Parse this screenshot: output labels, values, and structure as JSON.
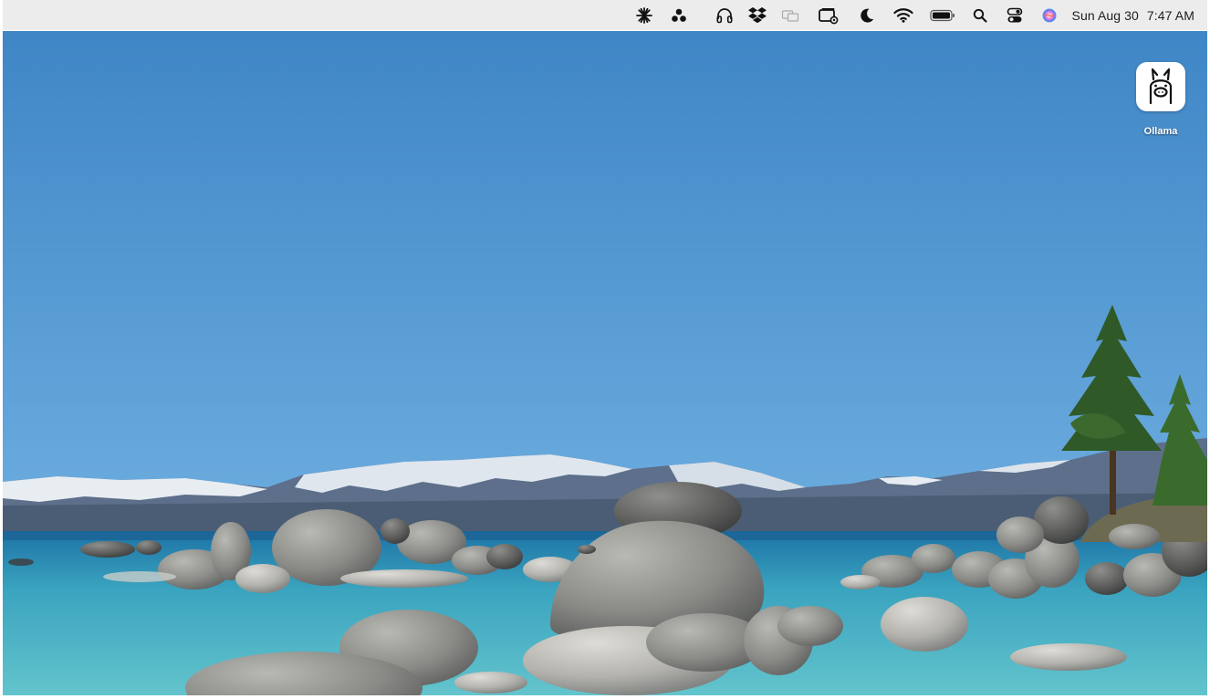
{
  "menubar": {
    "icons": [
      "perplexity-icon",
      "recycle-triangle-icon",
      "headphones-icon",
      "dropbox-icon",
      "screen-mirror-icon",
      "display-settings-icon",
      "moon-focus-icon",
      "wifi-icon",
      "battery-icon",
      "spotlight-search-icon",
      "control-center-icon",
      "siri-icon"
    ],
    "date": "Sun Aug 30",
    "time": "7:47 AM"
  },
  "desktop": {
    "icons": [
      {
        "label": "Ollama",
        "icon": "ollama-llama-icon"
      }
    ]
  },
  "colors": {
    "menubar_bg": "#ececec",
    "sky_top": "#3f86c6",
    "sky_bottom": "#6eaee0",
    "water": "#4fb8c8"
  }
}
